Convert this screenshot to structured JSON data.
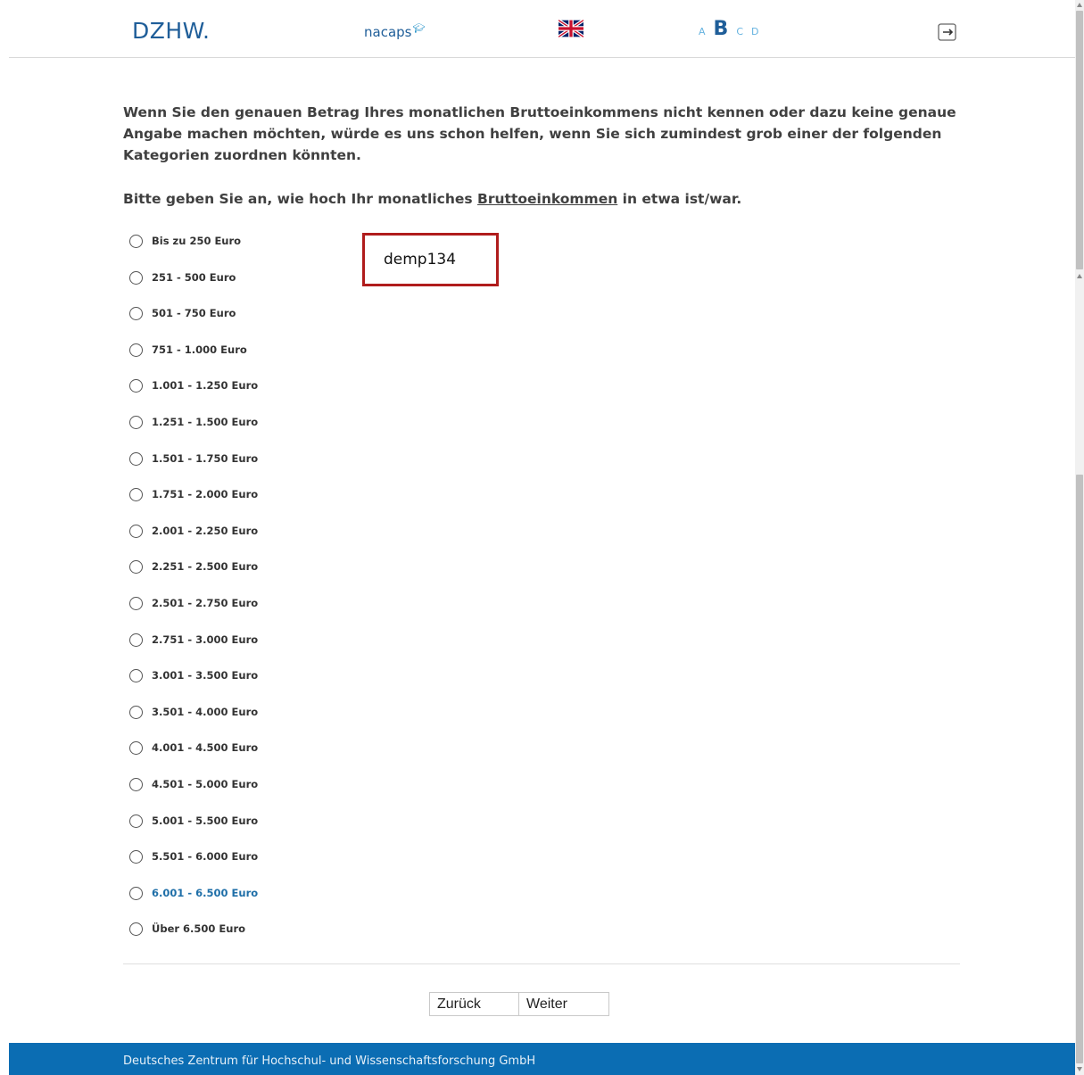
{
  "header": {
    "logo_dzhw": "DZHW.",
    "logo_nacaps": "nacaps",
    "language_icon": "uk-flag-icon",
    "font_sizes": [
      "A",
      "B",
      "C",
      "D"
    ],
    "logout_icon": "logout-icon"
  },
  "intro_text": "Wenn Sie den genauen Betrag Ihres monatlichen Bruttoeinkommens nicht kennen oder dazu keine genaue Angabe machen möchten, würde es uns schon helfen, wenn Sie sich zumindest grob einer der folgenden Kategorien zuordnen könnten.",
  "question": {
    "before": "Bitte geben Sie an, wie hoch Ihr monatliches ",
    "underlined": "Bruttoeinkommen",
    "after": " in etwa ist/war."
  },
  "options": [
    "Bis zu 250 Euro",
    "251 - 500 Euro",
    "501 - 750 Euro",
    "751 - 1.000 Euro",
    "1.001 - 1.250 Euro",
    "1.251 - 1.500 Euro",
    "1.501 - 1.750 Euro",
    "1.751 - 2.000 Euro",
    "2.001 - 2.250 Euro",
    "2.251 - 2.500 Euro",
    "2.501 - 2.750 Euro",
    "2.751 - 3.000 Euro",
    "3.001 - 3.500 Euro",
    "3.501 - 4.000 Euro",
    "4.001 - 4.500 Euro",
    "4.501 - 5.000 Euro",
    "5.001 - 5.500 Euro",
    "5.501 - 6.000 Euro",
    "6.001 - 6.500 Euro",
    "Über 6.500 Euro"
  ],
  "hovered_option_index": 18,
  "variable_label": "demp134",
  "nav": {
    "back": "Zurück",
    "next": "Weiter"
  },
  "footer_text": "Deutsches Zentrum für Hochschul- und Wissenschaftsforschung GmbH",
  "colors": {
    "brand": "#1f5e99",
    "footer": "#0b6db3",
    "annotation_border": "#b01c1c",
    "hover_option": "#1f6fa8"
  }
}
